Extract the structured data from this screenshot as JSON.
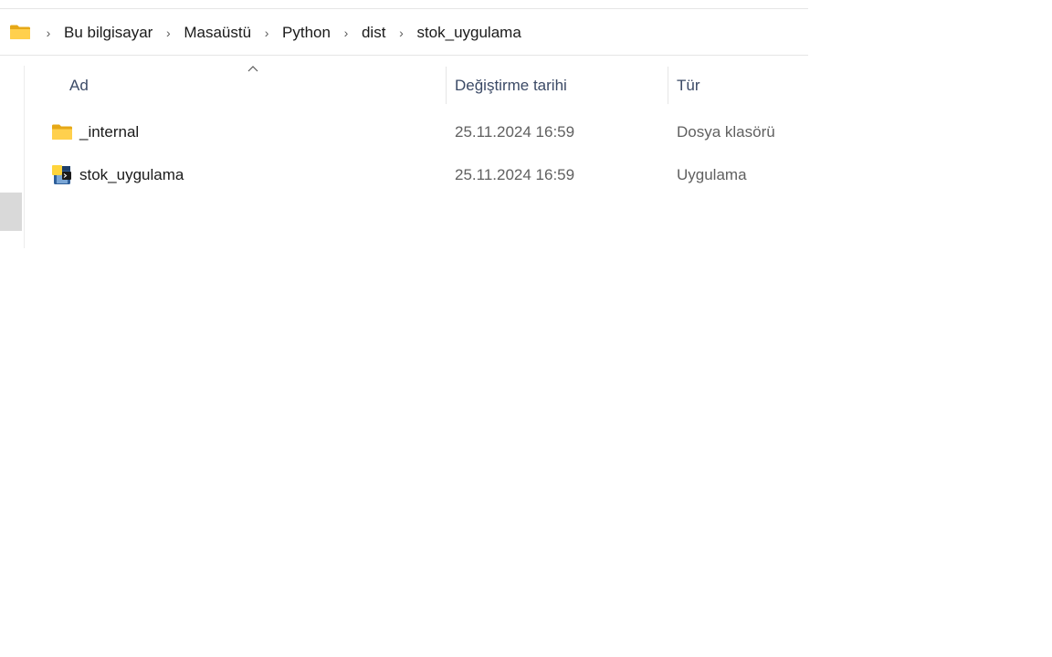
{
  "breadcrumb": {
    "items": [
      "Bu bilgisayar",
      "Masaüstü",
      "Python",
      "dist",
      "stok_uygulama"
    ]
  },
  "columns": {
    "name": "Ad",
    "modified": "Değiştirme tarihi",
    "type": "Tür"
  },
  "files": [
    {
      "name": "_internal",
      "modified": "25.11.2024 16:59",
      "type": "Dosya klasörü",
      "icon": "folder-icon"
    },
    {
      "name": "stok_uygulama",
      "modified": "25.11.2024 16:59",
      "type": "Uygulama",
      "icon": "python-app-icon"
    }
  ],
  "colors": {
    "folder": "#f5c542",
    "header_text": "#3b4a66",
    "secondary_text": "#606060"
  }
}
